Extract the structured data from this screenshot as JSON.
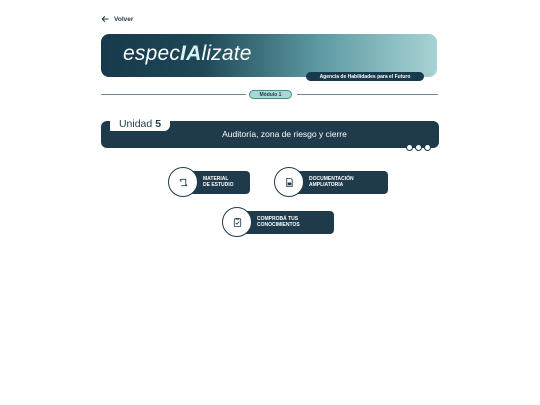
{
  "nav": {
    "back_label": "Volver"
  },
  "banner": {
    "brand_prefix": "espec",
    "brand_highlight": "IA",
    "brand_suffix": "lizate",
    "tagline": "Agencia de Habilidades para el Futuro"
  },
  "module": {
    "label": "Módulo 1"
  },
  "unit": {
    "label": "Unidad",
    "number": "5",
    "title": "Auditoría, zona de riesgo y cierre"
  },
  "actions": [
    {
      "label": "MATERIAL\nDE ESTUDIO",
      "icon": "scroll-icon"
    },
    {
      "label": "DOCUMENTACIÓN\nAMPLIATORIA",
      "icon": "document-icon"
    },
    {
      "label": "COMPROBÁ TUS\nCONOCIMIENTOS",
      "icon": "clipboard-check-icon"
    }
  ],
  "colors": {
    "primary": "#1e3a4b",
    "accent": "#a4dbd6"
  }
}
